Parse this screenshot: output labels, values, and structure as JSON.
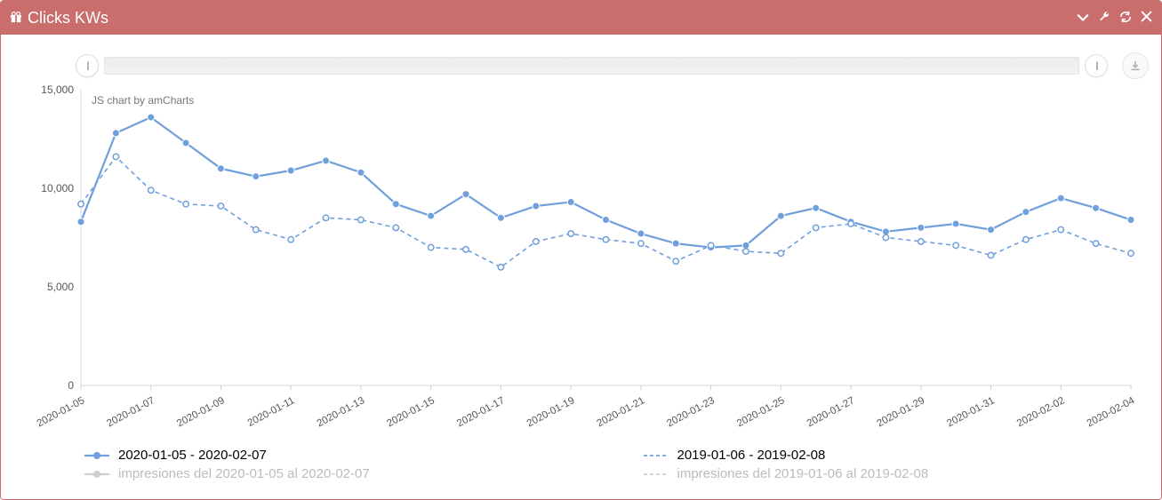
{
  "header": {
    "icon": "gift-icon",
    "title": "Clicks KWs"
  },
  "attribution": "JS chart by amCharts",
  "y_ticks": [
    "0",
    "5,000",
    "10,000",
    "15,000"
  ],
  "x_ticks": [
    "2020-01-05",
    "2020-01-07",
    "2020-01-09",
    "2020-01-11",
    "2020-01-13",
    "2020-01-15",
    "2020-01-17",
    "2020-01-19",
    "2020-01-21",
    "2020-01-23",
    "2020-01-25",
    "2020-01-27",
    "2020-01-29",
    "2020-01-31",
    "2020-02-02",
    "2020-02-04"
  ],
  "legend": {
    "s1": "2020-01-05 - 2020-02-07",
    "s2": "2019-01-06 - 2019-02-08",
    "s3": "impresiones del 2020-01-05 al 2020-02-07",
    "s4": "impresiones del 2019-01-06 al 2019-02-08"
  },
  "chart_data": {
    "type": "line",
    "title": "Clicks KWs",
    "xlabel": "",
    "ylabel": "",
    "ylim": [
      0,
      15000
    ],
    "categories": [
      "2020-01-05",
      "2020-01-06",
      "2020-01-07",
      "2020-01-08",
      "2020-01-09",
      "2020-01-10",
      "2020-01-11",
      "2020-01-12",
      "2020-01-13",
      "2020-01-14",
      "2020-01-15",
      "2020-01-16",
      "2020-01-17",
      "2020-01-18",
      "2020-01-19",
      "2020-01-20",
      "2020-01-21",
      "2020-01-22",
      "2020-01-23",
      "2020-01-24",
      "2020-01-25",
      "2020-01-26",
      "2020-01-27",
      "2020-01-28",
      "2020-01-29",
      "2020-01-30",
      "2020-01-31",
      "2020-02-01",
      "2020-02-02",
      "2020-02-03",
      "2020-02-04"
    ],
    "series": [
      {
        "name": "2020-01-05 - 2020-02-07",
        "style": "solid",
        "values": [
          8300,
          12800,
          13600,
          12300,
          11000,
          10600,
          10900,
          11400,
          10800,
          9200,
          8600,
          9700,
          8500,
          9100,
          9300,
          8400,
          7700,
          7200,
          7000,
          7100,
          8600,
          9000,
          8300,
          7800,
          8000,
          8200,
          7900,
          8800,
          9500,
          9000,
          8400
        ]
      },
      {
        "name": "2019-01-06 - 2019-02-08",
        "style": "dashed",
        "values": [
          9200,
          11600,
          9900,
          9200,
          9100,
          7900,
          7400,
          8500,
          8400,
          8000,
          7000,
          6900,
          6000,
          7300,
          7700,
          7400,
          7200,
          6300,
          7100,
          6800,
          6700,
          8000,
          8200,
          7500,
          7300,
          7100,
          6600,
          7400,
          7900,
          7200,
          6700
        ]
      }
    ],
    "additional_series_labels": [
      "impresiones del 2020-01-05 al 2020-02-07",
      "impresiones del 2019-01-06 al 2019-02-08"
    ],
    "legend_position": "bottom",
    "grid": false
  }
}
